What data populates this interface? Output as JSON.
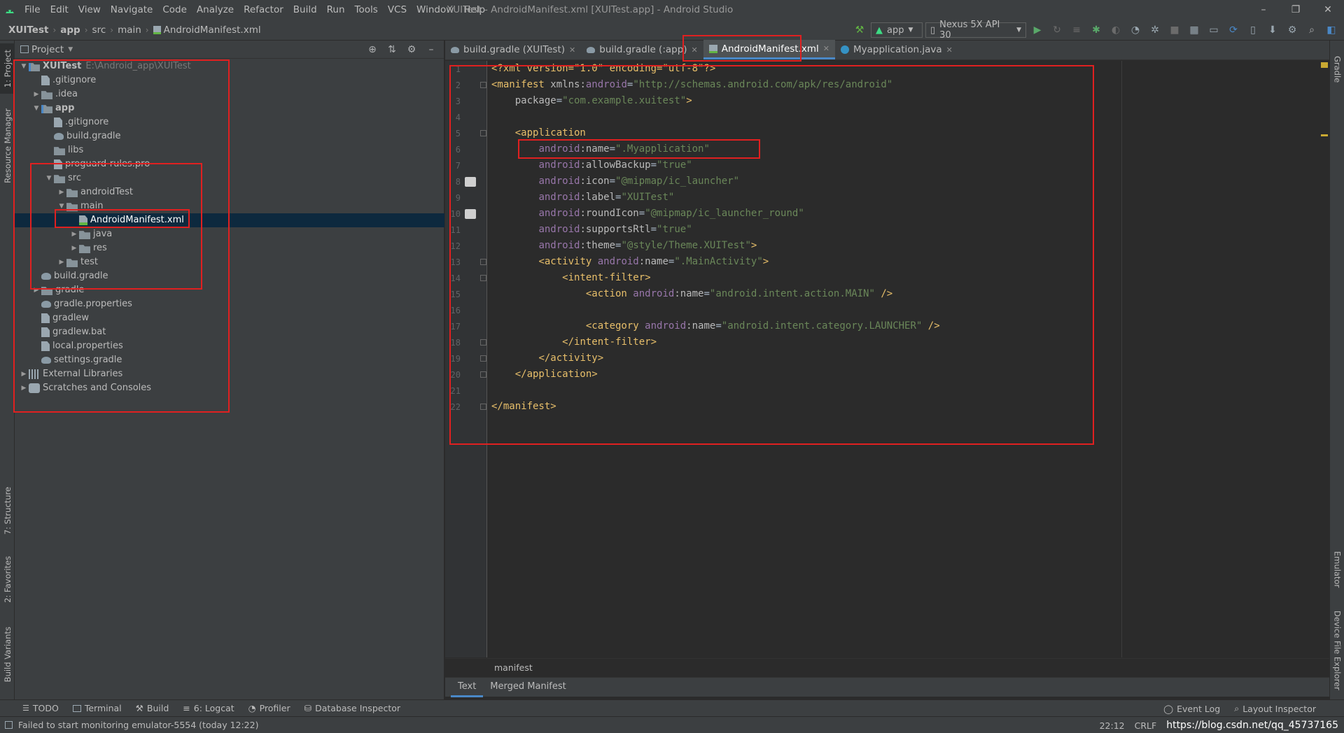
{
  "menubar": {
    "items": [
      "File",
      "Edit",
      "View",
      "Navigate",
      "Code",
      "Analyze",
      "Refactor",
      "Build",
      "Run",
      "Tools",
      "VCS",
      "Window",
      "Help"
    ],
    "window_title": "XUITest - AndroidManifest.xml [XUITest.app] - Android Studio"
  },
  "navbar": {
    "crumbs": [
      "XUITest",
      "app",
      "src",
      "main",
      "AndroidManifest.xml"
    ],
    "run_config": "app",
    "device": "Nexus 5X API 30"
  },
  "project_panel": {
    "title": "Project",
    "tree": [
      {
        "label": "XUITest",
        "hint": "E:\\Android_app\\XUITest",
        "depth": 0,
        "arrow": "open",
        "icon": "module",
        "bold": true
      },
      {
        "label": ".gitignore",
        "depth": 1,
        "arrow": "",
        "icon": "file"
      },
      {
        "label": ".idea",
        "depth": 1,
        "arrow": "closed",
        "icon": "folder"
      },
      {
        "label": "app",
        "depth": 1,
        "arrow": "open",
        "icon": "module",
        "bold": true
      },
      {
        "label": ".gitignore",
        "depth": 2,
        "arrow": "",
        "icon": "file"
      },
      {
        "label": "build.gradle",
        "depth": 2,
        "arrow": "",
        "icon": "gradle"
      },
      {
        "label": "libs",
        "depth": 2,
        "arrow": "",
        "icon": "folder"
      },
      {
        "label": "proguard-rules.pro",
        "depth": 2,
        "arrow": "",
        "icon": "file"
      },
      {
        "label": "src",
        "depth": 2,
        "arrow": "open",
        "icon": "folder"
      },
      {
        "label": "androidTest",
        "depth": 3,
        "arrow": "closed",
        "icon": "folder"
      },
      {
        "label": "main",
        "depth": 3,
        "arrow": "open",
        "icon": "folder"
      },
      {
        "label": "AndroidManifest.xml",
        "depth": 4,
        "arrow": "",
        "icon": "xml",
        "selected": true
      },
      {
        "label": "java",
        "depth": 4,
        "arrow": "closed",
        "icon": "folder"
      },
      {
        "label": "res",
        "depth": 4,
        "arrow": "closed",
        "icon": "folder"
      },
      {
        "label": "test",
        "depth": 3,
        "arrow": "closed",
        "icon": "folder"
      },
      {
        "label": "build.gradle",
        "depth": 1,
        "arrow": "",
        "icon": "gradle"
      },
      {
        "label": "gradle",
        "depth": 1,
        "arrow": "closed",
        "icon": "folder"
      },
      {
        "label": "gradle.properties",
        "depth": 1,
        "arrow": "",
        "icon": "gradle"
      },
      {
        "label": "gradlew",
        "depth": 1,
        "arrow": "",
        "icon": "file"
      },
      {
        "label": "gradlew.bat",
        "depth": 1,
        "arrow": "",
        "icon": "file"
      },
      {
        "label": "local.properties",
        "depth": 1,
        "arrow": "",
        "icon": "file"
      },
      {
        "label": "settings.gradle",
        "depth": 1,
        "arrow": "",
        "icon": "gradle"
      },
      {
        "label": "External Libraries",
        "depth": 0,
        "arrow": "closed",
        "icon": "lib"
      },
      {
        "label": "Scratches and Consoles",
        "depth": 0,
        "arrow": "closed",
        "icon": "scratch"
      }
    ]
  },
  "editor_tabs": [
    {
      "label": "build.gradle (XUITest)",
      "icon": "gradle",
      "active": false
    },
    {
      "label": "build.gradle (:app)",
      "icon": "gradle",
      "active": false
    },
    {
      "label": "AndroidManifest.xml",
      "icon": "xml",
      "active": true
    },
    {
      "label": "Myapplication.java",
      "icon": "java",
      "active": false
    }
  ],
  "code": {
    "line_numbers": [
      "1",
      "2",
      "3",
      "4",
      "5",
      "6",
      "7",
      "8",
      "9",
      "10",
      "11",
      "12",
      "13",
      "14",
      "15",
      "16",
      "17",
      "18",
      "19",
      "20",
      "21",
      "22"
    ],
    "lines": [
      [
        [
          "pi",
          "<?xml version=\"1.0\" encoding=\"utf-8\"?>"
        ]
      ],
      [
        [
          "tag",
          "<manifest "
        ],
        [
          "attr",
          "xmlns:"
        ],
        [
          "ns",
          "android"
        ],
        [
          "plain",
          "="
        ],
        [
          "val",
          "\"http://schemas.android.com/apk/res/android\""
        ]
      ],
      [
        [
          "plain",
          "    "
        ],
        [
          "attr",
          "package"
        ],
        [
          "plain",
          "="
        ],
        [
          "val",
          "\"com.example.xuitest\""
        ],
        [
          "tag",
          ">"
        ]
      ],
      [],
      [
        [
          "plain",
          "    "
        ],
        [
          "tag",
          "<application"
        ]
      ],
      [
        [
          "plain",
          "        "
        ],
        [
          "ns",
          "android"
        ],
        [
          "attr",
          ":name"
        ],
        [
          "plain",
          "="
        ],
        [
          "val",
          "\".Myapplication\""
        ]
      ],
      [
        [
          "plain",
          "        "
        ],
        [
          "ns",
          "android"
        ],
        [
          "attr",
          ":allowBackup"
        ],
        [
          "plain",
          "="
        ],
        [
          "val",
          "\"true\""
        ]
      ],
      [
        [
          "plain",
          "        "
        ],
        [
          "ns",
          "android"
        ],
        [
          "attr",
          ":icon"
        ],
        [
          "plain",
          "="
        ],
        [
          "val",
          "\"@mipmap/ic_launcher\""
        ]
      ],
      [
        [
          "plain",
          "        "
        ],
        [
          "ns",
          "android"
        ],
        [
          "attr",
          ":label"
        ],
        [
          "plain",
          "="
        ],
        [
          "val",
          "\"XUITest\""
        ]
      ],
      [
        [
          "plain",
          "        "
        ],
        [
          "ns",
          "android"
        ],
        [
          "attr",
          ":roundIcon"
        ],
        [
          "plain",
          "="
        ],
        [
          "val",
          "\"@mipmap/ic_launcher_round\""
        ]
      ],
      [
        [
          "plain",
          "        "
        ],
        [
          "ns",
          "android"
        ],
        [
          "attr",
          ":supportsRtl"
        ],
        [
          "plain",
          "="
        ],
        [
          "val",
          "\"true\""
        ]
      ],
      [
        [
          "plain",
          "        "
        ],
        [
          "ns",
          "android"
        ],
        [
          "attr",
          ":theme"
        ],
        [
          "plain",
          "="
        ],
        [
          "val",
          "\"@style/Theme.XUITest\""
        ],
        [
          "tag",
          ">"
        ]
      ],
      [
        [
          "plain",
          "        "
        ],
        [
          "tag",
          "<activity "
        ],
        [
          "ns",
          "android"
        ],
        [
          "attr",
          ":name"
        ],
        [
          "plain",
          "="
        ],
        [
          "val",
          "\".MainActivity\""
        ],
        [
          "tag",
          ">"
        ]
      ],
      [
        [
          "plain",
          "            "
        ],
        [
          "tag",
          "<intent-filter>"
        ]
      ],
      [
        [
          "plain",
          "                "
        ],
        [
          "tag",
          "<action "
        ],
        [
          "ns",
          "android"
        ],
        [
          "attr",
          ":name"
        ],
        [
          "plain",
          "="
        ],
        [
          "val",
          "\"android.intent.action.MAIN\""
        ],
        [
          "tag",
          " />"
        ]
      ],
      [],
      [
        [
          "plain",
          "                "
        ],
        [
          "tag",
          "<category "
        ],
        [
          "ns",
          "android"
        ],
        [
          "attr",
          ":name"
        ],
        [
          "plain",
          "="
        ],
        [
          "val",
          "\"android.intent.category.LAUNCHER\""
        ],
        [
          "tag",
          " />"
        ]
      ],
      [
        [
          "plain",
          "            "
        ],
        [
          "tag",
          "</intent-filter>"
        ]
      ],
      [
        [
          "plain",
          "        "
        ],
        [
          "tag",
          "</activity>"
        ]
      ],
      [
        [
          "plain",
          "    "
        ],
        [
          "tag",
          "</application>"
        ]
      ],
      [],
      [
        [
          "tag",
          "</manifest>"
        ]
      ]
    ]
  },
  "breadcrumb": "manifest",
  "bottom_editor_tabs": [
    "Text",
    "Merged Manifest"
  ],
  "tool_windows_left": [
    "TODO",
    "Terminal",
    "Build",
    "6: Logcat",
    "Profiler",
    "Database Inspector"
  ],
  "tool_windows_right": [
    "Event Log",
    "Layout Inspector"
  ],
  "side_tabs_left": [
    "1: Project",
    "Resource Manager",
    "7: Structure",
    "2: Favorites",
    "Build Variants"
  ],
  "side_tabs_right": [
    "Gradle",
    "Emulator",
    "Device File Explorer"
  ],
  "status": {
    "message": "Failed to start monitoring emulator-5554 (today 12:22)",
    "position": "22:12",
    "line_sep": "CRLF",
    "url": "https://blog.csdn.net/qq_45737165"
  },
  "colors": {
    "bg_editor": "#2b2b2b",
    "bg_panel": "#3c3f41",
    "annotation_red": "#e02020",
    "selection": "#0d293e",
    "accent": "#4a88c7"
  }
}
